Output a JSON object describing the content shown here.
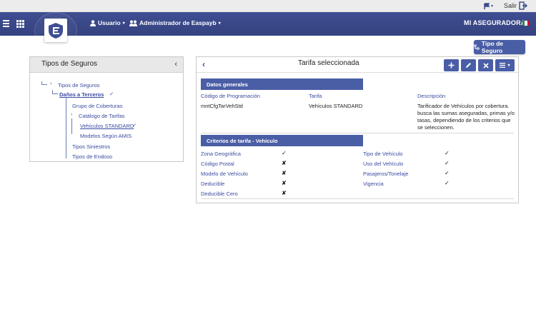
{
  "util": {
    "salir": "Salir",
    "colors": {
      "bar": "#ececec"
    }
  },
  "nav": {
    "user_label": "Usuario",
    "admin_label": "Administrador de Easpayb",
    "brand": "MI ASEGURADORA",
    "colors": {
      "bg": "#3f4e92",
      "accent": "#4a5ea6"
    }
  },
  "tipo_button": {
    "label": "Tipo de Seguro"
  },
  "left": {
    "title": "Tipos de Seguros",
    "tree": [
      {
        "label": "Tipos de Seguros"
      },
      {
        "label": "Daños a Terceros"
      },
      {
        "label": "Grupo de Coberturas"
      },
      {
        "label": "Catálogo de Tarifas"
      },
      {
        "label": "Vehículos STANDARD"
      },
      {
        "label": "Modelos Según AMIS"
      },
      {
        "label": "Tipos Siniestros"
      },
      {
        "label": "Tipos de Endoso"
      }
    ]
  },
  "right": {
    "title": "Tarifa seleccionada",
    "actions": [
      "add-icon",
      "edit-icon",
      "delete-icon",
      "menu-icon"
    ],
    "general": {
      "header": "Datos generales",
      "col_codigo": "Código de Programación",
      "col_tarifa": "Tarifa",
      "col_desc": "Descripción",
      "codigo": "mntCfgTarVehStd",
      "tarifa": "Vehículos STANDARD",
      "descripcion": "Tarificador de Vehículos por cobertura. busca las sumas aseguradas, primas y/o tasas, dependiendo de los criterios que se seleccionen."
    },
    "criterios": {
      "header": "Criterios de tarifa - Vehículo",
      "left": [
        {
          "label": "Zona Geográfica",
          "mark": "✓"
        },
        {
          "label": "Código Postal",
          "mark": "✘"
        },
        {
          "label": "Modelo de Vehículo",
          "mark": "✘"
        },
        {
          "label": "Deducible",
          "mark": "✘"
        },
        {
          "label": "Deducible Cero",
          "mark": "✘"
        }
      ],
      "right": [
        {
          "label": "Tipo de Vehículo",
          "mark": "✓"
        },
        {
          "label": "Uso del Vehículo",
          "mark": "✓"
        },
        {
          "label": "Pasajeros/Tonelaje",
          "mark": "✓"
        },
        {
          "label": "Vigencia",
          "mark": "✓"
        }
      ]
    }
  }
}
